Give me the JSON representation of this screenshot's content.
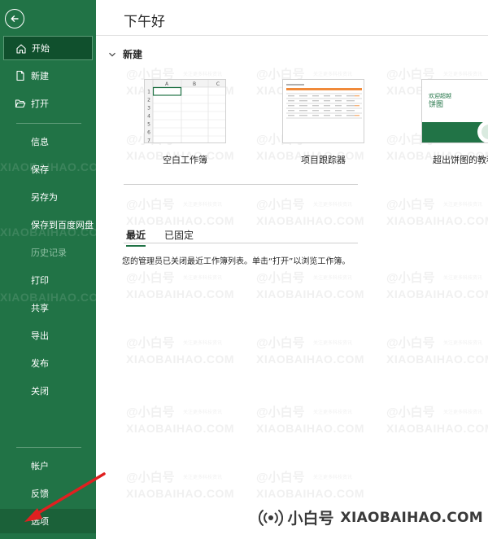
{
  "sidebar": {
    "items": [
      {
        "label": "开始",
        "icon": "home-icon"
      },
      {
        "label": "新建",
        "icon": "new-doc-icon"
      },
      {
        "label": "打开",
        "icon": "folder-open-icon"
      },
      {
        "label": "信息"
      },
      {
        "label": "保存"
      },
      {
        "label": "另存为"
      },
      {
        "label": "保存到百度网盘"
      },
      {
        "label": "历史记录"
      },
      {
        "label": "打印"
      },
      {
        "label": "共享"
      },
      {
        "label": "导出"
      },
      {
        "label": "发布"
      },
      {
        "label": "关闭"
      },
      {
        "label": "帐户"
      },
      {
        "label": "反馈"
      },
      {
        "label": "选项"
      }
    ]
  },
  "main": {
    "greeting": "下午好",
    "new_section": "新建",
    "templates": [
      {
        "label": "空白工作簿"
      },
      {
        "label": "项目跟踪器"
      },
      {
        "label": "超出饼图的教程",
        "thumb_text_1": "欢迎超越",
        "thumb_text_2": "饼图"
      }
    ],
    "tabs": [
      {
        "label": "最近"
      },
      {
        "label": "已固定"
      }
    ],
    "message": "您的管理员已关闭最近工作簿列表。单击“打开”以浏览工作簿。"
  },
  "blank_grid": {
    "columns": [
      "A",
      "B",
      "C"
    ],
    "rows": [
      "1",
      "2",
      "3",
      "4",
      "5",
      "6",
      "7"
    ]
  },
  "watermark": {
    "line1": "@小白号",
    "line2": "XIAOBAIHAO.COM",
    "tagline": "关注更多科技资讯"
  },
  "brand": {
    "cn": "小白号",
    "en": "XIAOBAIHAO.COM"
  },
  "colors": {
    "sidebar": "#217346",
    "active_item": "#10502d",
    "arrow": "#e02020"
  }
}
